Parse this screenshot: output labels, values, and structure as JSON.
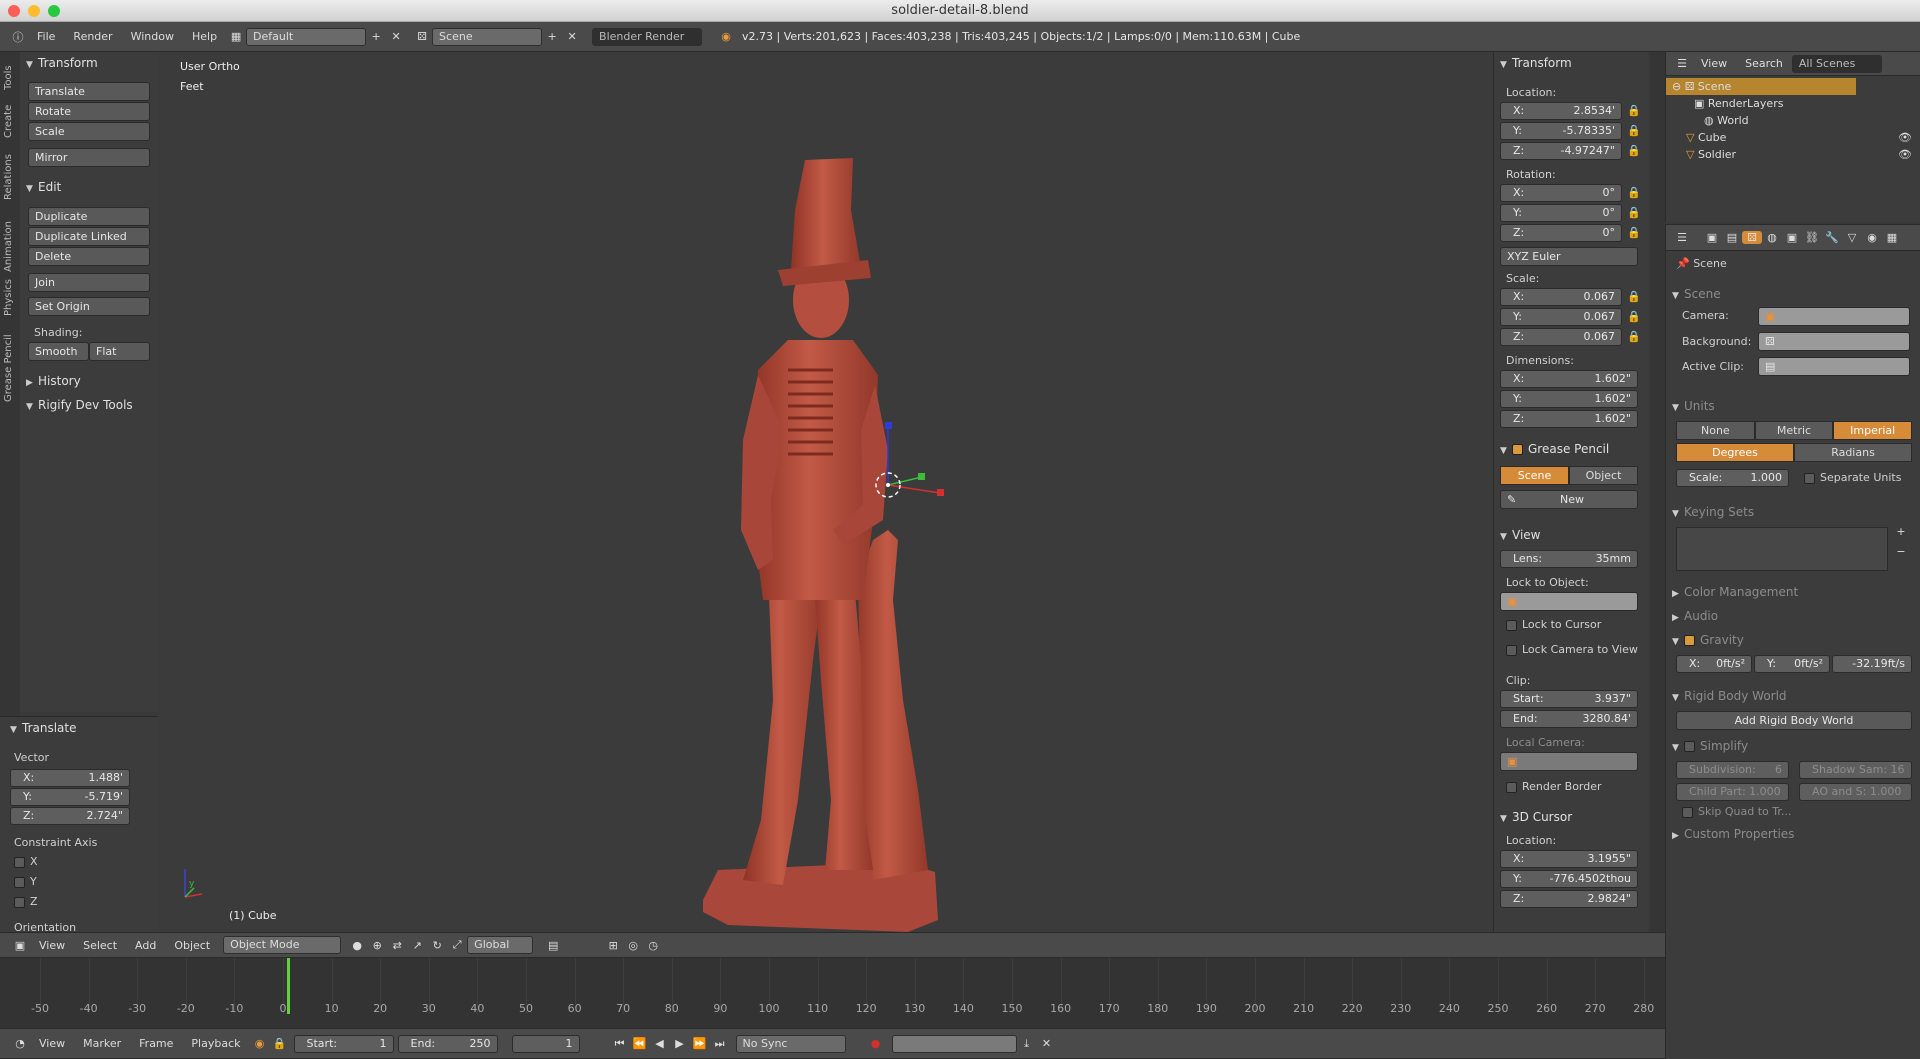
{
  "window": {
    "title": "soldier-detail-8.blend"
  },
  "info_header": {
    "menus": [
      "File",
      "Render",
      "Window",
      "Help"
    ],
    "layout": "Default",
    "scene": "Scene",
    "engine": "Blender Render",
    "stats": "v2.73 | Verts:201,623 | Faces:403,238 | Tris:403,245 | Objects:1/2 | Lamps:0/0 | Mem:110.63M | Cube"
  },
  "tool_tabs": [
    "Tools",
    "Create",
    "Relations",
    "Animation",
    "Physics",
    "Grease Pencil"
  ],
  "toolshelf": {
    "transform": {
      "title": "Transform",
      "buttons": [
        "Translate",
        "Rotate",
        "Scale",
        "Mirror"
      ]
    },
    "edit": {
      "title": "Edit",
      "buttons": [
        "Duplicate",
        "Duplicate Linked",
        "Delete",
        "Join",
        "Set Origin"
      ]
    },
    "shading": {
      "label": "Shading:",
      "smooth": "Smooth",
      "flat": "Flat"
    },
    "history": "History",
    "rigify": "Rigify Dev Tools"
  },
  "operator": {
    "title": "Translate",
    "vector_label": "Vector",
    "x": "1.488'",
    "y": "-5.719'",
    "z": "2.724\"",
    "constraint_label": "Constraint Axis",
    "axes": [
      "X",
      "Y",
      "Z"
    ],
    "orientation": "Orientation"
  },
  "viewport": {
    "view_name": "User Ortho",
    "units": "Feet",
    "object_label": "(1) Cube",
    "axis_x": "x",
    "axis_y": "y",
    "axis_z": "z"
  },
  "view3d_header": {
    "menus": [
      "View",
      "Select",
      "Add",
      "Object"
    ],
    "mode": "Object Mode",
    "orientation": "Global"
  },
  "properties_n": {
    "transform": {
      "title": "Transform",
      "location_label": "Location:",
      "location": {
        "x": "2.8534'",
        "y": "-5.78335'",
        "z": "-4.97247\""
      },
      "rotation_label": "Rotation:",
      "rotation": {
        "x": "0°",
        "y": "0°",
        "z": "0°"
      },
      "rotation_mode": "XYZ Euler",
      "scale_label": "Scale:",
      "scale": {
        "x": "0.067",
        "y": "0.067",
        "z": "0.067"
      },
      "dimensions_label": "Dimensions:",
      "dimensions": {
        "x": "1.602\"",
        "y": "1.602\"",
        "z": "1.602\""
      }
    },
    "grease_pencil": {
      "title": "Grease Pencil",
      "scene": "Scene",
      "object": "Object",
      "new": "New"
    },
    "view": {
      "title": "View",
      "lens_label": "Lens:",
      "lens": "35mm",
      "lock_object_label": "Lock to Object:",
      "lock_cursor": "Lock to Cursor",
      "lock_camera": "Lock Camera to View",
      "clip_label": "Clip:",
      "start_label": "Start:",
      "start": "3.937\"",
      "end_label": "End:",
      "end": "3280.84'",
      "local_camera": "Local Camera:",
      "render_border": "Render Border"
    },
    "cursor": {
      "title": "3D Cursor",
      "location_label": "Location:",
      "x": "3.1955\"",
      "y": "-776.4502thou",
      "z": "2.9824\""
    },
    "axis": {
      "x": "X:",
      "y": "Y:",
      "z": "Z:"
    }
  },
  "outliner": {
    "menus": [
      "View",
      "Search"
    ],
    "filter": "All Scenes",
    "items": [
      "Scene",
      "RenderLayers",
      "World",
      "Cube",
      "Soldier"
    ]
  },
  "properties": {
    "breadcrumb": "Scene",
    "scene_panel": {
      "title": "Scene",
      "camera_label": "Camera:",
      "background_label": "Background:",
      "clip_label": "Active Clip:"
    },
    "units": {
      "title": "Units",
      "systems": [
        "None",
        "Metric",
        "Imperial"
      ],
      "rotation": [
        "Degrees",
        "Radians"
      ],
      "scale_label": "Scale:",
      "scale": "1.000",
      "separate": "Separate Units"
    },
    "keying_sets": "Keying Sets",
    "color_management": "Color Management",
    "audio": "Audio",
    "gravity": {
      "title": "Gravity",
      "x_label": "X:",
      "x": "0ft/s²",
      "y_label": "Y:",
      "y": "0ft/s²",
      "z": "-32.19ft/s"
    },
    "rigid_body": {
      "title": "Rigid Body World",
      "button": "Add Rigid Body World"
    },
    "simplify": {
      "title": "Simplify",
      "subdivision_label": "Subdivision:",
      "subdivision": "6",
      "shadow_label": "Shadow Sam: 16",
      "child_label": "Child Part: 1.000",
      "ao_label": "AO and S: 1.000",
      "skip_quad": "Skip Quad to Tr..."
    },
    "custom": "Custom Properties"
  },
  "timeline": {
    "labels": [
      "-50",
      "-40",
      "-30",
      "-20",
      "-10",
      "0",
      "10",
      "20",
      "30",
      "40",
      "50",
      "60",
      "70",
      "80",
      "90",
      "100",
      "110",
      "120",
      "130",
      "140",
      "150",
      "160",
      "170",
      "180",
      "190",
      "200",
      "210",
      "220",
      "230",
      "240",
      "250",
      "260",
      "270",
      "280"
    ],
    "current_frame": 1
  },
  "timeline_header": {
    "menus": [
      "View",
      "Marker",
      "Frame",
      "Playback"
    ],
    "start_label": "Start:",
    "start": "1",
    "end_label": "End:",
    "end": "250",
    "frame": "1",
    "sync": "No Sync"
  },
  "colors": {
    "accent": "#d58b38",
    "statue": "#b24a3a",
    "frame_line": "#5fd23c"
  }
}
